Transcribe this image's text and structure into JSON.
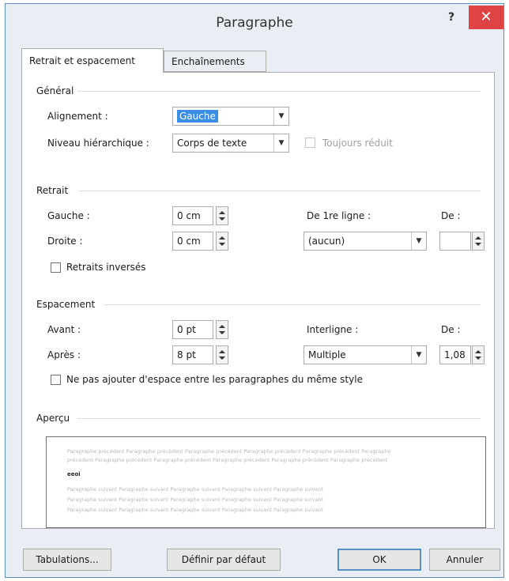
{
  "dialog": {
    "title": "Paragraphe",
    "help": "?",
    "close": "✕"
  },
  "tabs": [
    "Retrait et espacement",
    "Enchaînements"
  ],
  "general": {
    "heading": "Général",
    "alignment_label": "Alignement :",
    "alignment_value": "Gauche",
    "level_label": "Niveau hiérarchique :",
    "level_value": "Corps de texte",
    "collapsed_label": "Toujours réduit"
  },
  "indent": {
    "heading": "Retrait",
    "left_label": "Gauche :",
    "left_value": "0 cm",
    "right_label": "Droite :",
    "right_value": "0 cm",
    "first_line_label": "De 1re ligne :",
    "first_line_value": "(aucun)",
    "by_label": "De :",
    "by_value": "",
    "mirror_label": "Retraits inversés"
  },
  "spacing": {
    "heading": "Espacement",
    "before_label": "Avant :",
    "before_value": "0 pt",
    "after_label": "Après :",
    "after_value": "8 pt",
    "line_spacing_label": "Interligne :",
    "line_spacing_value": "Multiple",
    "at_label": "De :",
    "at_value": "1,08",
    "no_space_label": "Ne pas ajouter d'espace entre les paragraphes du même style"
  },
  "preview": {
    "heading": "Aperçu",
    "prev_lines": [
      "Paragraphe précédent Paragraphe précédent Paragraphe précédent Paragraphe précédent Paragraphe précédent Paragraphe",
      "précédent Paragraphe précédent Paragraphe précédent Paragraphe précédent Paragraphe précédent Paragraphe précédent"
    ],
    "current": "eeoi",
    "next_lines": [
      "Paragraphe suivant Paragraphe suivant Paragraphe suivant Paragraphe suivant Paragraphe suivant",
      "Paragraphe suivant Paragraphe suivant Paragraphe suivant Paragraphe suivant Paragraphe suivant",
      "Paragraphe suivant Paragraphe suivant Paragraphe suivant Paragraphe suivant Paragraphe suivant"
    ]
  },
  "buttons": {
    "tabs": "Tabulations...",
    "default": "Définir par défaut",
    "ok": "OK",
    "cancel": "Annuler"
  },
  "colors": {
    "title_bar": "#e9eef4",
    "close": "#e04343",
    "selection": "#3a8ee6",
    "focus_border": "#5a8fc7"
  }
}
